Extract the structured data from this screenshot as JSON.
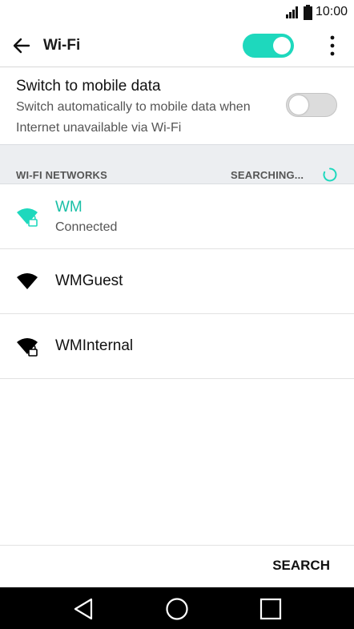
{
  "status_bar": {
    "time": "10:00",
    "signal_icon": "signal-bars-icon",
    "battery_icon": "battery-icon"
  },
  "header": {
    "back_icon": "arrow-back-icon",
    "title": "Wi-Fi",
    "wifi_enabled": true,
    "overflow_icon": "more-vertical-icon"
  },
  "mobile_data": {
    "title": "Switch to mobile data",
    "subtitle": "Switch automatically to mobile data when Internet unavailable via Wi-Fi",
    "enabled": false
  },
  "section": {
    "title": "WI-FI NETWORKS",
    "status": "SEARCHING..."
  },
  "networks": [
    {
      "name": "WM",
      "status": "Connected",
      "secured": true,
      "connected": true
    },
    {
      "name": "WMGuest",
      "status": "",
      "secured": false,
      "connected": false
    },
    {
      "name": "WMInternal",
      "status": "",
      "secured": true,
      "connected": false
    }
  ],
  "footer": {
    "search_label": "SEARCH"
  },
  "nav": {
    "back_icon": "nav-back-icon",
    "home_icon": "nav-home-icon",
    "recents_icon": "nav-recents-icon"
  },
  "colors": {
    "accent": "#1ed8bd",
    "connected_text": "#19bfa6",
    "section_bg": "#eceef1"
  }
}
